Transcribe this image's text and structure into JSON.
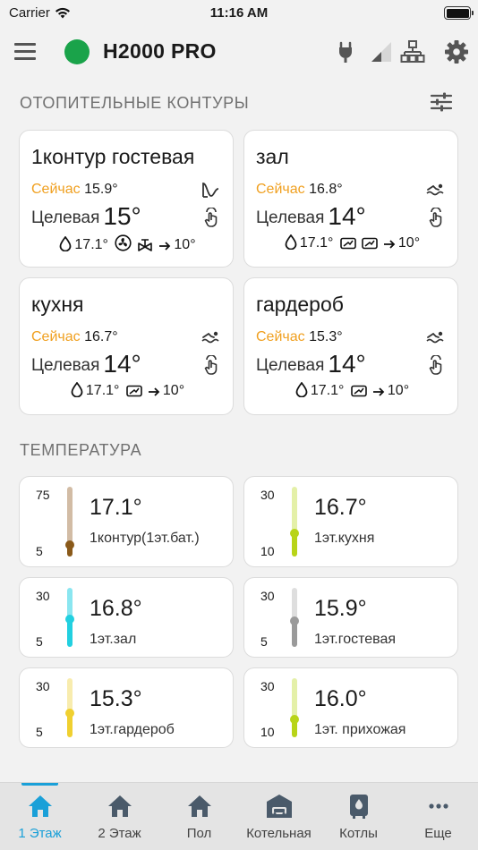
{
  "status_bar": {
    "carrier": "Carrier",
    "time": "11:16 AM"
  },
  "app_bar": {
    "title": "H2000 PRO",
    "status_color": "#1aa34a"
  },
  "heating": {
    "section_title": "ОТОПИТЕЛЬНЫЕ КОНТУРЫ",
    "now_label": "Сейчас",
    "target_label": "Целевая",
    "zones": [
      {
        "name": "1контур гостевая",
        "now": "15.9°",
        "target": "15°",
        "humidity": "17.1°",
        "outdoor": "10°"
      },
      {
        "name": "зал",
        "now": "16.8°",
        "target": "14°",
        "humidity": "17.1°",
        "outdoor": "10°"
      },
      {
        "name": "кухня",
        "now": "16.7°",
        "target": "14°",
        "humidity": "17.1°",
        "outdoor": "10°"
      },
      {
        "name": "гардероб",
        "now": "15.3°",
        "target": "14°",
        "humidity": "17.1°",
        "outdoor": "10°"
      }
    ]
  },
  "temperature": {
    "section_title": "ТЕМПЕРАТУРА",
    "sensors": [
      {
        "value": "17.1°",
        "name": "1контур(1эт.бат.)",
        "max": "75",
        "min": "5",
        "level": 0.17,
        "color": "#d2bca5",
        "knob": "#8a5a1a"
      },
      {
        "value": "16.7°",
        "name": "1эт.кухня",
        "max": "30",
        "min": "10",
        "level": 0.33,
        "color": "#e4f0a8",
        "knob": "#b8d418"
      },
      {
        "value": "16.8°",
        "name": "1эт.зал",
        "max": "30",
        "min": "5",
        "level": 0.47,
        "color": "#8ae6f0",
        "knob": "#22d0e0"
      },
      {
        "value": "15.9°",
        "name": "1эт.гостевая",
        "max": "30",
        "min": "5",
        "level": 0.44,
        "color": "#dedede",
        "knob": "#9a9a9a"
      },
      {
        "value": "15.3°",
        "name": "1эт.гардероб",
        "max": "30",
        "min": "5",
        "level": 0.41,
        "color": "#f8ecae",
        "knob": "#f0d030"
      },
      {
        "value": "16.0°",
        "name": "1эт. прихожая",
        "max": "30",
        "min": "10",
        "level": 0.3,
        "color": "#e4f0a8",
        "knob": "#b8d418"
      }
    ]
  },
  "tabs": [
    {
      "label": "1 Этаж",
      "icon": "home-icon",
      "active": true
    },
    {
      "label": "2 Этаж",
      "icon": "home-icon",
      "active": false
    },
    {
      "label": "Пол",
      "icon": "home-icon",
      "active": false
    },
    {
      "label": "Котельная",
      "icon": "garage-icon",
      "active": false
    },
    {
      "label": "Котлы",
      "icon": "boiler-icon",
      "active": false
    },
    {
      "label": "Еще",
      "icon": "more-icon",
      "active": false
    }
  ],
  "colors": {
    "accent": "#1aa0d8",
    "now_label": "#f0a020",
    "ok": "#1aa34a"
  }
}
